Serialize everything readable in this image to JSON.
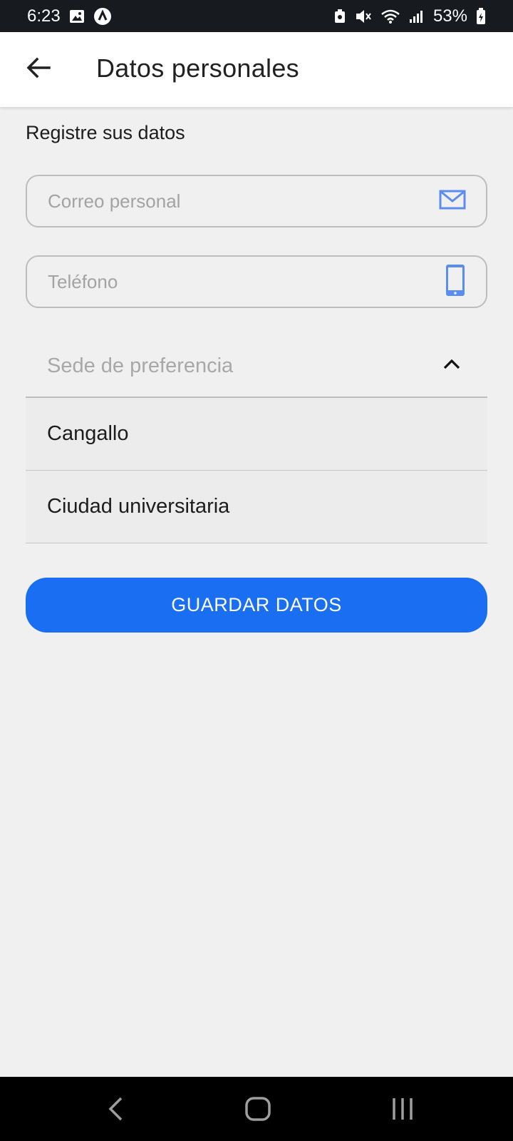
{
  "status_bar": {
    "time": "6:23",
    "battery_percent": "53%",
    "icons": [
      "image-icon",
      "app-notification-icon",
      "lock-battery-icon",
      "mute-icon",
      "wifi-icon",
      "signal-icon",
      "battery-charging-icon"
    ]
  },
  "app_bar": {
    "title": "Datos personales",
    "back_icon": "arrow-left-icon"
  },
  "form": {
    "section_label": "Registre sus datos",
    "email": {
      "placeholder": "Correo personal",
      "value": "",
      "icon": "mail-icon"
    },
    "phone": {
      "placeholder": "Teléfono",
      "value": "",
      "icon": "smartphone-icon"
    },
    "sede": {
      "placeholder": "Sede de preferencia",
      "icon": "chevron-up-icon",
      "options": [
        "Cangallo",
        "Ciudad universitaria"
      ]
    },
    "save_label": "GUARDAR DATOS"
  },
  "colors": {
    "accent": "#1a6ef2",
    "field_icon": "#5b8def",
    "status_bar": "#171b20"
  },
  "nav_bar": {
    "icons": [
      "back-nav-icon",
      "home-nav-icon",
      "recents-nav-icon"
    ]
  }
}
